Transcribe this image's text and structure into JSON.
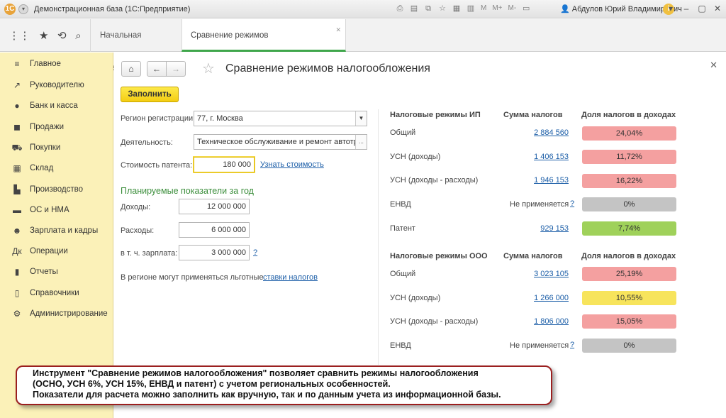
{
  "window": {
    "title": "Демонстрационная база  (1С:Предприятие)",
    "user": "Абдулов Юрий Владимирович",
    "memory_buttons": [
      "M",
      "M+",
      "M-"
    ]
  },
  "tabs": [
    {
      "label": "Начальная страница",
      "active": false
    },
    {
      "label": "Сравнение режимов налогообложения",
      "active": true
    }
  ],
  "sidebar": {
    "items": [
      {
        "label": "Главное",
        "icon": "hamburger-icon"
      },
      {
        "label": "Руководителю",
        "icon": "trend-icon"
      },
      {
        "label": "Банк и касса",
        "icon": "coin-icon"
      },
      {
        "label": "Продажи",
        "icon": "bag-icon"
      },
      {
        "label": "Покупки",
        "icon": "cart-icon"
      },
      {
        "label": "Склад",
        "icon": "grid-icon"
      },
      {
        "label": "Производство",
        "icon": "factory-icon"
      },
      {
        "label": "ОС и НМА",
        "icon": "truck-icon"
      },
      {
        "label": "Зарплата и кадры",
        "icon": "person-icon"
      },
      {
        "label": "Операции",
        "icon": "operations-icon"
      },
      {
        "label": "Отчеты",
        "icon": "bar-chart-icon"
      },
      {
        "label": "Справочники",
        "icon": "book-icon"
      },
      {
        "label": "Администрирование",
        "icon": "gear-icon"
      }
    ]
  },
  "form": {
    "title": "Сравнение режимов налогообложения",
    "fill_button": "Заполнить",
    "region_label": "Регион регистрации:",
    "region_value": "77, г. Москва",
    "activity_label": "Деятельность:",
    "activity_value": "Техническое обслуживание и ремонт автотр",
    "patent_label": "Стоимость патента:",
    "patent_value": "180 000",
    "patent_link": "Узнать стоимость",
    "planned_title": "Планируемые показатели за год",
    "income_label": "Доходы:",
    "income_value": "12 000 000",
    "expenses_label": "Расходы:",
    "expenses_value": "6 000 000",
    "salary_label": "в т. ч. зарплата:",
    "salary_value": "3 000 000",
    "help_mark": "?",
    "note_text": "В регионе могут применяться льготные",
    "note_link": "ставки налогов"
  },
  "ip_table": {
    "headers": [
      "Налоговые режимы ИП",
      "Сумма налогов",
      "Доля налогов в доходах"
    ],
    "rows": [
      {
        "regime": "Общий",
        "amount": "2 884 560",
        "share": "24,04%",
        "color": "#f4a0a0"
      },
      {
        "regime": "УСН (доходы)",
        "amount": "1 406 153",
        "share": "11,72%",
        "color": "#f4a0a0"
      },
      {
        "regime": "УСН (доходы - расходы)",
        "amount": "1 946 153",
        "share": "16,22%",
        "color": "#f4a0a0"
      },
      {
        "regime": "ЕНВД",
        "amount": "Не применяется",
        "share": "0%",
        "color": "#c4c4c4",
        "na": true
      },
      {
        "regime": "Патент",
        "amount": "929 153",
        "share": "7,74%",
        "color": "#9fd15a"
      }
    ]
  },
  "ooo_table": {
    "headers": [
      "Налоговые режимы ООО",
      "Сумма налогов",
      "Доля налогов в доходах"
    ],
    "rows": [
      {
        "regime": "Общий",
        "amount": "3 023 105",
        "share": "25,19%",
        "color": "#f4a0a0"
      },
      {
        "regime": "УСН (доходы)",
        "amount": "1 266 000",
        "share": "10,55%",
        "color": "#f7e45c"
      },
      {
        "regime": "УСН (доходы - расходы)",
        "amount": "1 806 000",
        "share": "15,05%",
        "color": "#f4a0a0"
      },
      {
        "regime": "ЕНВД",
        "amount": "Не применяется",
        "share": "0%",
        "color": "#c4c4c4",
        "na": true
      }
    ]
  },
  "callout": {
    "line1": "Инструмент \"Сравнение режимов налогообложения\" позволяет сравнить режимы налогообложения",
    "line2": "(ОСНО, УСН 6%, УСН 15%, ЕНВД и патент) с учетом региональных особенностей.",
    "line3": "Показатели для расчета можно заполнить как вручную, так и по данным учета из информационной базы."
  }
}
